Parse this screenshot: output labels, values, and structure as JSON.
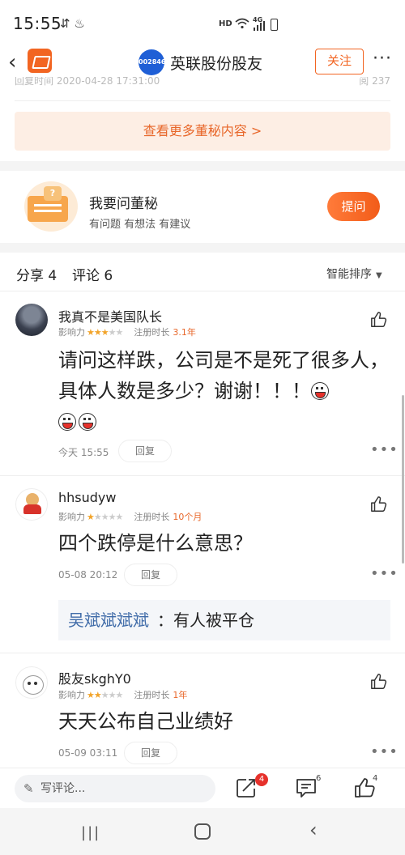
{
  "status_bar": {
    "time": "15:55",
    "network": "HD",
    "signal": "4G"
  },
  "header": {
    "stock_code": "002846",
    "title": "英联股份股友",
    "follow_label": "关注",
    "more_label": "···"
  },
  "previous": {
    "reply_time": "回复时间 2020-04-28 17:31:00",
    "reads": "阅 237"
  },
  "more_secretary_label": "查看更多董秘内容 >",
  "ask": {
    "title": "我要问董秘",
    "subtitle": "有问题 有想法 有建议",
    "button": "提问",
    "icon_mark": "?"
  },
  "tabs": {
    "share": "分享 4",
    "comment": "评论 6",
    "sort": "智能排序"
  },
  "comments": [
    {
      "user": "我真不是美国队长",
      "influence_label": "影响力",
      "stars": 3,
      "stars_total": 5,
      "tenure_label": "注册时长",
      "tenure": "3.1年",
      "text": "请问这样跌，公司是不是死了很多人，具体人数是多少？谢谢！！！",
      "time": "今天 15:55",
      "reply_label": "回复"
    },
    {
      "user": "hhsudyw",
      "influence_label": "影响力",
      "stars": 1,
      "stars_total": 5,
      "tenure_label": "注册时长",
      "tenure": "10个月",
      "text": "四个跌停是什么意思？",
      "time": "05-08 20:12",
      "reply_label": "回复",
      "sub_reply": {
        "user": "吴斌斌斌斌",
        "separator": "：",
        "text": "有人被平仓"
      }
    },
    {
      "user": "股友skghY0",
      "influence_label": "影响力",
      "stars": 2,
      "stars_total": 5,
      "tenure_label": "注册时长",
      "tenure": "1年",
      "text": "天天公布自己业绩好",
      "time": "05-09 03:11",
      "reply_label": "回复"
    }
  ],
  "bottom_bar": {
    "write_placeholder": "写评论...",
    "share_badge": "4",
    "comment_count": "6",
    "like_count": "4"
  },
  "colors": {
    "accent": "#f26522",
    "link": "#3f6ba8",
    "star": "#f2a42a"
  },
  "icons": {
    "back": "chevron-left-icon",
    "share": "share-icon",
    "comment": "comment-icon",
    "like": "thumbs-up-icon",
    "edit": "pen-icon"
  }
}
